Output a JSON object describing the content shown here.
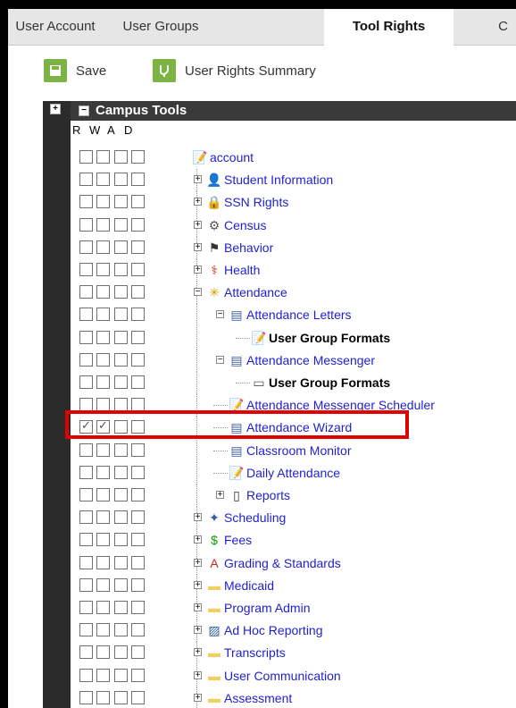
{
  "tabs": [
    {
      "label": "User Account"
    },
    {
      "label": "User Groups"
    },
    {
      "label": "Tool Rights"
    },
    {
      "label": "C"
    }
  ],
  "toolbar": {
    "save_label": "Save",
    "summary_label": "User Rights Summary"
  },
  "tree_header": {
    "title": "Campus Tools"
  },
  "columns": [
    "R",
    "W",
    "A",
    "D"
  ],
  "colors": {
    "accent_green": "#7cb342",
    "link_blue": "#1f1fd0",
    "highlight_red": "#e00000"
  },
  "rows": [
    {
      "label": "account",
      "icon": "edit-icon",
      "checks": [
        false,
        false,
        false,
        false
      ]
    },
    {
      "label": "Student Information",
      "icon": "student-icon",
      "checks": [
        false,
        false,
        false,
        false
      ]
    },
    {
      "label": "SSN Rights",
      "icon": "lock-icon",
      "checks": [
        false,
        false,
        false,
        false
      ]
    },
    {
      "label": "Census",
      "icon": "census-icon",
      "checks": [
        false,
        false,
        false,
        false
      ]
    },
    {
      "label": "Behavior",
      "icon": "behavior-icon",
      "checks": [
        false,
        false,
        false,
        false
      ]
    },
    {
      "label": "Health",
      "icon": "health-icon",
      "checks": [
        false,
        false,
        false,
        false
      ]
    },
    {
      "label": "Attendance",
      "icon": "attendance-icon",
      "checks": [
        false,
        false,
        false,
        false
      ]
    },
    {
      "label": "Attendance Letters",
      "icon": "windows-icon",
      "checks": [
        false,
        false,
        false,
        false
      ]
    },
    {
      "label": "User Group Formats",
      "icon": "edit-icon",
      "checks": [
        false,
        false,
        false,
        false
      ]
    },
    {
      "label": "Attendance Messenger",
      "icon": "windows-icon",
      "checks": [
        false,
        false,
        false,
        false
      ]
    },
    {
      "label": "User Group Formats",
      "icon": "window-icon",
      "checks": [
        false,
        false,
        false,
        false
      ]
    },
    {
      "label": "Attendance Messenger Scheduler",
      "icon": "edit-icon",
      "checks": [
        false,
        false,
        false,
        false
      ]
    },
    {
      "label": "Attendance Wizard",
      "icon": "windows-icon",
      "checks": [
        true,
        true,
        false,
        false
      ]
    },
    {
      "label": "Classroom Monitor",
      "icon": "windows-icon",
      "checks": [
        false,
        false,
        false,
        false
      ]
    },
    {
      "label": "Daily Attendance",
      "icon": "edit-icon",
      "checks": [
        false,
        false,
        false,
        false
      ]
    },
    {
      "label": "Reports",
      "icon": "document-icon",
      "checks": [
        false,
        false,
        false,
        false
      ]
    },
    {
      "label": "Scheduling",
      "icon": "scheduling-icon",
      "checks": [
        false,
        false,
        false,
        false
      ]
    },
    {
      "label": "Fees",
      "icon": "dollar-icon",
      "checks": [
        false,
        false,
        false,
        false
      ]
    },
    {
      "label": "Grading & Standards",
      "icon": "grade-icon",
      "checks": [
        false,
        false,
        false,
        false
      ]
    },
    {
      "label": "Medicaid",
      "icon": "folder-icon",
      "checks": [
        false,
        false,
        false,
        false
      ]
    },
    {
      "label": "Program Admin",
      "icon": "folder-icon",
      "checks": [
        false,
        false,
        false,
        false
      ]
    },
    {
      "label": "Ad Hoc Reporting",
      "icon": "chart-icon",
      "checks": [
        false,
        false,
        false,
        false
      ]
    },
    {
      "label": "Transcripts",
      "icon": "folder-icon",
      "checks": [
        false,
        false,
        false,
        false
      ]
    },
    {
      "label": "User Communication",
      "icon": "folder-icon",
      "checks": [
        false,
        false,
        false,
        false
      ]
    },
    {
      "label": "Assessment",
      "icon": "folder-icon",
      "checks": [
        false,
        false,
        false,
        false
      ]
    }
  ]
}
